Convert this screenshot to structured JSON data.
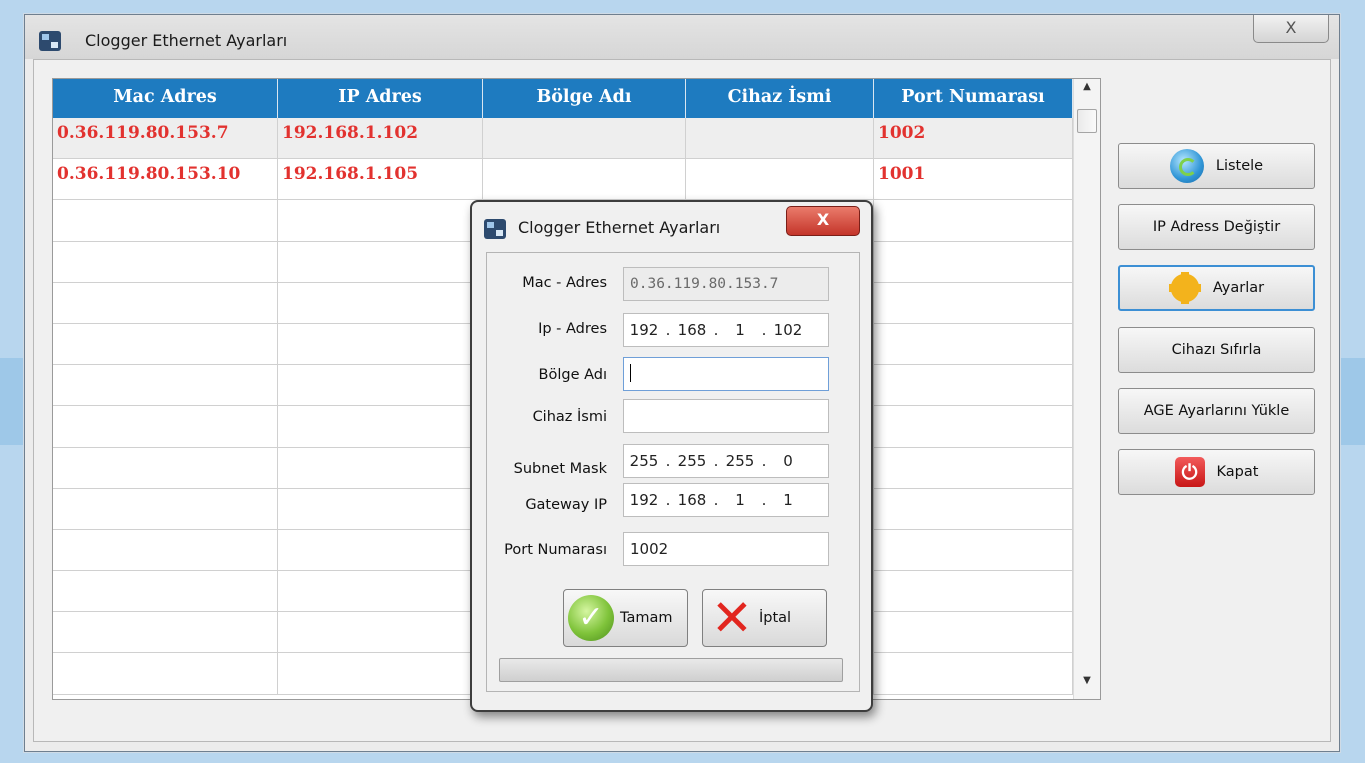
{
  "main_window": {
    "title": "Clogger Ethernet Ayarları",
    "close_glyph": "X"
  },
  "table": {
    "columns": [
      "Mac Adres",
      "IP Adres",
      "Bölge Adı",
      "Cihaz İsmi",
      "Port Numarası"
    ],
    "rows": [
      [
        "0.36.119.80.153.7",
        "192.168.1.102",
        "",
        "",
        "1002"
      ],
      [
        "0.36.119.80.153.10",
        "192.168.1.105",
        "",
        "",
        "1001"
      ]
    ],
    "selected_row": 0,
    "header_color": "#1e7bc0",
    "row_text_color": "#e2322f"
  },
  "side_buttons": {
    "listele": "Listele",
    "ip_degistir": "IP Adress Değiştir",
    "ayarlar": "Ayarlar",
    "sifirla": "Cihazı Sıfırla",
    "age_yukle": "AGE Ayarlarını Yükle",
    "kapat": "Kapat"
  },
  "dialog": {
    "title": "Clogger Ethernet Ayarları",
    "close_glyph": "X",
    "fields": {
      "mac": {
        "label": "Mac - Adres",
        "value": "0.36.119.80.153.7"
      },
      "ip": {
        "label": "Ip - Adres",
        "octets": [
          "192",
          "168",
          "1",
          "102"
        ]
      },
      "bolge": {
        "label": "Bölge Adı",
        "value": ""
      },
      "cihaz": {
        "label": "Cihaz İsmi",
        "value": ""
      },
      "subnet": {
        "label": "Subnet Mask",
        "octets": [
          "255",
          "255",
          "255",
          "0"
        ]
      },
      "gateway": {
        "label": "Gateway IP",
        "octets": [
          "192",
          "168",
          "1",
          "1"
        ]
      },
      "port": {
        "label": "Port Numarası",
        "value": "1002"
      }
    },
    "buttons": {
      "ok": "Tamam",
      "cancel": "İptal"
    },
    "progress": 0
  },
  "icons": {
    "app": "app-icon",
    "listele": "refresh-icon",
    "ayarlar": "gear-icon",
    "kapat": "power-icon",
    "ok": "check-icon",
    "cancel": "x-icon"
  }
}
